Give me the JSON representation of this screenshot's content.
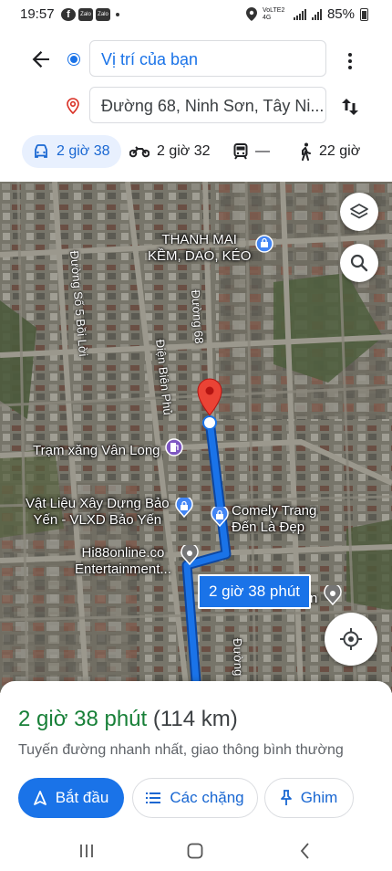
{
  "status_bar": {
    "time": "19:57",
    "app_icons": [
      "Facebook",
      "Zalo",
      "Zalo"
    ],
    "network": "VoLTE2 4G",
    "battery": "85%"
  },
  "directions": {
    "origin": "Vị trí của bạn",
    "destination": "Đường 68, Ninh Sơn, Tây Ni...",
    "accent_color": "#1a73e8"
  },
  "modes": [
    {
      "icon": "car-icon",
      "label": "2 giờ 38",
      "active": true
    },
    {
      "icon": "motorbike-icon",
      "label": "2 giờ 32",
      "active": false
    },
    {
      "icon": "transit-icon",
      "label": "—",
      "active": false
    },
    {
      "icon": "walk-icon",
      "label": "22 giờ",
      "active": false
    }
  ],
  "map": {
    "places": {
      "thanh_mai": "THANH MAI\nKỀM, DAO, KÉO",
      "tram_xang": "Trạm xăng Vân Long",
      "vat_lieu": "Vật Liệu Xây Dựng Bảo\nYến - VLXD Bảo Yến",
      "comely": "Comely Trang\nĐến Là Đẹp",
      "hi88": "Hi88online.co\nEntertainment..."
    },
    "roads": {
      "duong_so_5": "Đường Số 5 Bồi Lời",
      "dien_bien_phu": "Điện Biên Phủ",
      "duong_68": "Đường 68",
      "duong_bottom": "Đường"
    },
    "route_callout": "2 giờ 38 phút",
    "partial_label": "n",
    "route_color": "#1a73e8"
  },
  "sheet": {
    "eta_time": "2 giờ 38 phút",
    "eta_distance": "(114 km)",
    "description": "Tuyến đường nhanh nhất, giao thông bình thường",
    "start_label": "Bắt đầu",
    "steps_label": "Các chặng",
    "pin_label": "Ghim"
  }
}
